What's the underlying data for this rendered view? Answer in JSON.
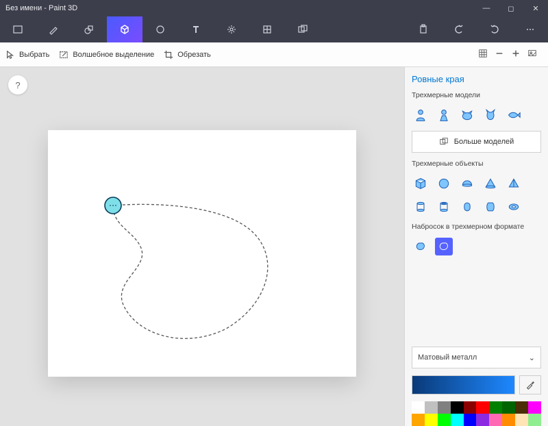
{
  "window": {
    "title": "Без имени - Paint 3D",
    "minimize": "—",
    "maximize": "◻",
    "close": "✕"
  },
  "toolbar": {
    "select": "Выбрать",
    "magic_select": "Волшебное выделение",
    "crop": "Обрезать"
  },
  "help": {
    "label": "?"
  },
  "sidebar": {
    "heading": "Ровные края",
    "models_label": "Трехмерные модели",
    "more_models": "Больше моделей",
    "objects_label": "Трехмерные объекты",
    "doodle_label": "Набросок в трехмерном формате",
    "material_label": "Матовый металл",
    "material_chevron": "⌄"
  },
  "palette": [
    "#ffffff",
    "#c0c0c0",
    "#808080",
    "#000000",
    "#8b0000",
    "#ff0000",
    "#008000",
    "#006400",
    "#4b2e05",
    "#ff00ff",
    "#ffa500",
    "#ffff00",
    "#00ff00",
    "#00ffff",
    "#0000ff",
    "#8a2be2",
    "#ff69b4",
    "#ff8c00",
    "#ffe4b5",
    "#90ee90"
  ]
}
